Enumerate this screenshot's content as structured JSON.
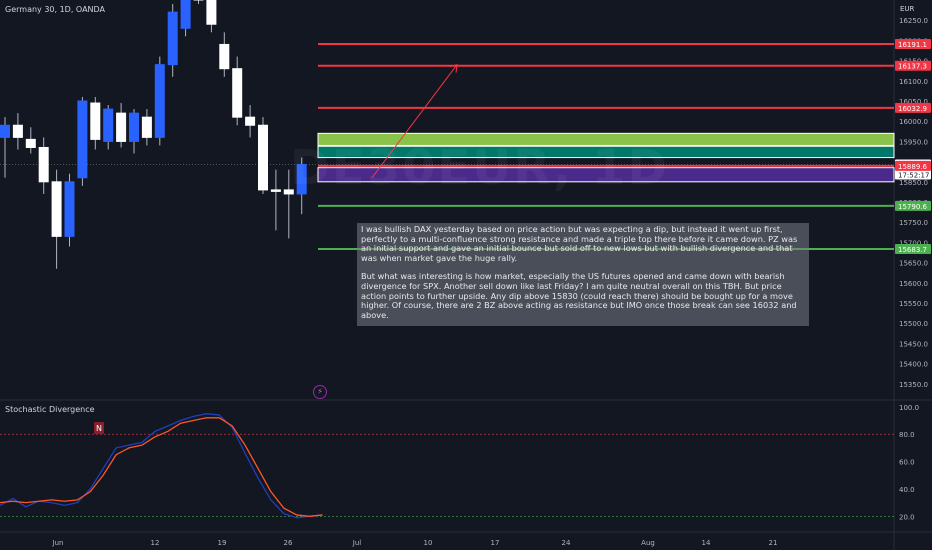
{
  "header": {
    "symbol_title": "Germany 30, 1D, OANDA",
    "currency": "EUR",
    "watermark": "DE30EUR, 1D"
  },
  "indicator": {
    "title": "Stochastic Divergence",
    "marker_label": "N",
    "y_ticks": [
      "100.0",
      "80.0",
      "60.0",
      "40.0",
      "20.0"
    ]
  },
  "note": {
    "paragraph1": "I was bullish DAX yesterday based on price action but was expecting a dip, but instead it went up first, perfectly to a multi-confluence strong resistance and made a triple top there before it came down. PZ was an initial support and gave an initial bounce but sold off to new lows but with bullish divergence and that was when market gave the huge rally.",
    "paragraph2": "But what was interesting is how market, especially the US futures opened and came down with bearish divergence for SPX. Another sell down like last Friday? I am quite neutral overall on this TBH. But price action points to further upside. Any dip above 15830 (could reach there) should be bought up for a move higher. Of course, there are 2 BZ above acting as resistance but IMO once those break can see 16032 and above."
  },
  "price_axis": {
    "ticks": [
      "16250.0",
      "16200.0",
      "16150.0",
      "16100.0",
      "16050.0",
      "16000.0",
      "15950.0",
      "15900.0",
      "15850.0",
      "15800.0",
      "15750.0",
      "15700.0",
      "15650.0",
      "15600.0",
      "15550.0",
      "15500.0",
      "15450.0",
      "15400.0",
      "15350.0"
    ],
    "labels": [
      {
        "text": "16191.1",
        "value": 16191.1,
        "color": "#f23645"
      },
      {
        "text": "16137.3",
        "value": 16137.3,
        "color": "#f23645"
      },
      {
        "text": "16032.9",
        "value": 16032.9,
        "color": "#f23645"
      },
      {
        "text": "15893.0",
        "value": 15893.0,
        "color": "#ffffff",
        "sub": "17:52:17"
      },
      {
        "text": "15889.6",
        "value": 15889.6,
        "color": "#f23645"
      },
      {
        "text": "15790.6",
        "value": 15790.6,
        "color": "#4caf50"
      },
      {
        "text": "15683.7",
        "value": 15683.7,
        "color": "#4caf50"
      }
    ]
  },
  "time_axis": {
    "ticks": [
      "Jun",
      "12",
      "19",
      "26",
      "Jul",
      "10",
      "17",
      "24",
      "Aug",
      "14",
      "21"
    ]
  },
  "chart_data": {
    "type": "candlestick",
    "title": "Germany 30, 1D, OANDA",
    "price_range": [
      15310,
      16300
    ],
    "candles": [
      {
        "o": 15960,
        "h": 16010,
        "l": 15860,
        "c": 15990,
        "dir": "up"
      },
      {
        "o": 15990,
        "h": 16020,
        "l": 15930,
        "c": 15960,
        "dir": "down"
      },
      {
        "o": 15955,
        "h": 15985,
        "l": 15920,
        "c": 15935,
        "dir": "down"
      },
      {
        "o": 15935,
        "h": 15960,
        "l": 15820,
        "c": 15850,
        "dir": "down"
      },
      {
        "o": 15850,
        "h": 15880,
        "l": 15635,
        "c": 15715,
        "dir": "down"
      },
      {
        "o": 15715,
        "h": 15870,
        "l": 15690,
        "c": 15850,
        "dir": "up"
      },
      {
        "o": 15860,
        "h": 16060,
        "l": 15840,
        "c": 16050,
        "dir": "up"
      },
      {
        "o": 16045,
        "h": 16060,
        "l": 15930,
        "c": 15955,
        "dir": "down"
      },
      {
        "o": 15950,
        "h": 16040,
        "l": 15930,
        "c": 16030,
        "dir": "up"
      },
      {
        "o": 16020,
        "h": 16045,
        "l": 15935,
        "c": 15950,
        "dir": "down"
      },
      {
        "o": 15950,
        "h": 16030,
        "l": 15920,
        "c": 16020,
        "dir": "up"
      },
      {
        "o": 16010,
        "h": 16030,
        "l": 15940,
        "c": 15960,
        "dir": "down"
      },
      {
        "o": 15960,
        "h": 16160,
        "l": 15940,
        "c": 16140,
        "dir": "up"
      },
      {
        "o": 16140,
        "h": 16290,
        "l": 16110,
        "c": 16270,
        "dir": "up"
      },
      {
        "o": 16230,
        "h": 16340,
        "l": 16210,
        "c": 16330,
        "dir": "up"
      },
      {
        "o": 16330,
        "h": 16360,
        "l": 16290,
        "c": 16300,
        "dir": "down"
      },
      {
        "o": 16330,
        "h": 16350,
        "l": 16220,
        "c": 16240,
        "dir": "down"
      },
      {
        "o": 16190,
        "h": 16220,
        "l": 16110,
        "c": 16130,
        "dir": "down"
      },
      {
        "o": 16130,
        "h": 16160,
        "l": 15990,
        "c": 16010,
        "dir": "down"
      },
      {
        "o": 16010,
        "h": 16040,
        "l": 15960,
        "c": 15990,
        "dir": "down"
      },
      {
        "o": 15990,
        "h": 16010,
        "l": 15820,
        "c": 15830,
        "dir": "down"
      },
      {
        "o": 15830,
        "h": 15880,
        "l": 15730,
        "c": 15830,
        "dir": "down"
      },
      {
        "o": 15830,
        "h": 15880,
        "l": 15710,
        "c": 15820,
        "dir": "down"
      },
      {
        "o": 15820,
        "h": 15910,
        "l": 15770,
        "c": 15893,
        "dir": "up"
      }
    ],
    "horizontal_levels": [
      {
        "value": 16191.1,
        "color": "#f23645"
      },
      {
        "value": 16137.3,
        "color": "#f23645"
      },
      {
        "value": 16032.9,
        "color": "#f23645"
      },
      {
        "value": 15889.6,
        "color": "#f23645"
      },
      {
        "value": 15790.6,
        "color": "#4caf50"
      },
      {
        "value": 15683.7,
        "color": "#4caf50"
      }
    ],
    "zones": [
      {
        "top": 15970,
        "bottom": 15940,
        "color": "#8bc34a"
      },
      {
        "top": 15938,
        "bottom": 15910,
        "color": "#00796b"
      },
      {
        "top": 15885,
        "bottom": 15850,
        "color": "#4a2a8a"
      }
    ],
    "projection": {
      "from": 15860,
      "to": 16140
    },
    "stochastic": {
      "range": [
        10,
        105
      ],
      "k": [
        28,
        33,
        27,
        31,
        30,
        28,
        30,
        40,
        55,
        70,
        72,
        74,
        82,
        86,
        90,
        93,
        95,
        94,
        85,
        66,
        48,
        32,
        22,
        19,
        20,
        21
      ],
      "d": [
        30,
        31,
        30,
        31,
        32,
        31,
        32,
        38,
        50,
        65,
        70,
        72,
        78,
        82,
        88,
        90,
        92,
        92,
        86,
        72,
        55,
        38,
        26,
        21,
        20,
        21
      ]
    }
  }
}
